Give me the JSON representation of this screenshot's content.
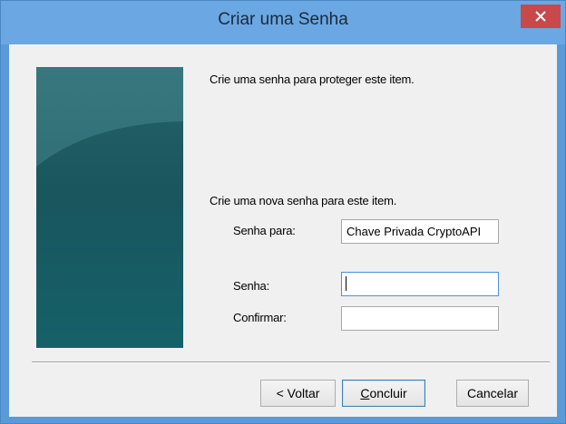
{
  "window": {
    "title": "Criar uma Senha",
    "close_symbol": "✕"
  },
  "content": {
    "intro": "Crie uma senha para proteger este item.",
    "section_label": "Crie uma nova senha para este item.",
    "password_for_label": "Senha para:",
    "password_for_value": "Chave Privada CryptoAPI",
    "password_label": "Senha:",
    "password_value": "",
    "confirm_label": "Confirmar:",
    "confirm_value": ""
  },
  "buttons": {
    "back": "< Voltar",
    "finish_accel": "C",
    "finish_rest": "oncluir",
    "cancel": "Cancelar"
  },
  "colors": {
    "titlebar": "#6aa7e3",
    "close": "#c9484a",
    "side_art": "#1c5961"
  }
}
